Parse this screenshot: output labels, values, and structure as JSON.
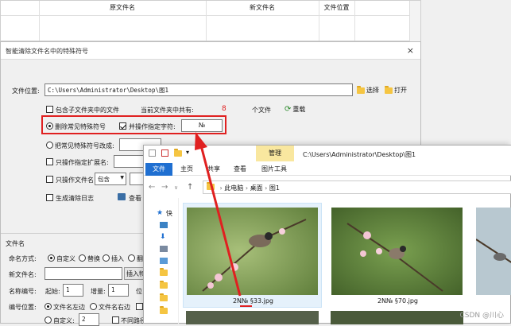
{
  "background_table": {
    "headers": [
      "原文件名",
      "新文件名",
      "文件位置"
    ]
  },
  "dialog": {
    "title": "智能清除文件名中的特殊符号",
    "close": "×",
    "path_label": "文件位置:",
    "path_value": "C:\\Users\\Administrator\\Desktop\\图1",
    "select_btn": "选择",
    "open_btn": "打开",
    "include_sub": "包含子文件夹中的文件",
    "count_prefix": "当前文件夹中共有:",
    "count_value": "8",
    "count_suffix": "个文件",
    "refresh": "重载",
    "opt_delete_common": "删除常见特殊符号",
    "opt_delete_specified": "并操作指定字符:",
    "specified_value": "№",
    "opt_replace": "把常见特殊符号改成:",
    "opt_only_ext": "只操作指定扩展名:",
    "opt_only_filename": "只操作文件名",
    "filename_mode": "包含",
    "opt_log": "生成清除日志",
    "view_label": "查看"
  },
  "lower_panel": {
    "section_title": "文件名",
    "naming_label": "命名方式:",
    "naming_options": [
      "自定义",
      "替换",
      "插入",
      "翻"
    ],
    "newname_label": "新文件名:",
    "insert_btn": "插入特",
    "number_label": "名称编号:",
    "start_label": "起始:",
    "start_value": "1",
    "step_label": "增量:",
    "step_value": "1",
    "pos_label": "位",
    "numpos_label": "编号位置:",
    "numpos_options": [
      "文件名左边",
      "文件名右边"
    ],
    "custom_label": "自定义:",
    "custom_value": "2",
    "nosame_label": "不同路径"
  },
  "explorer": {
    "manage_tab": "管理",
    "path_title": "C:\\Users\\Administrator\\Desktop\\图1",
    "ribbon_tabs": [
      "文件",
      "主页",
      "共享",
      "查看",
      "图片工具"
    ],
    "breadcrumb": [
      "此电脑",
      "桌面",
      "图1"
    ],
    "quick_access": "快",
    "files": [
      {
        "name": "2N№ §33.jpg"
      },
      {
        "name": "2N№ §70.jpg"
      },
      {
        "name": ""
      }
    ]
  },
  "annotation_color": "#e02020",
  "watermark": "CSDN @川心"
}
